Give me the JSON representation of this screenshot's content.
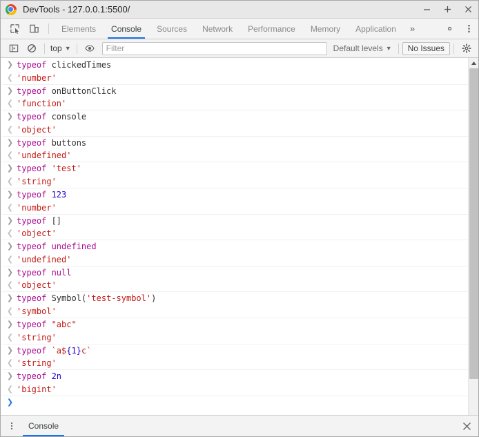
{
  "window": {
    "title": "DevTools - 127.0.0.1:5500/",
    "logo_icon": "chrome-logo-icon",
    "controls": {
      "minimize": "minimize-icon",
      "maximize": "maximize-icon",
      "close": "close-icon"
    }
  },
  "tabstrip": {
    "inspect_icon": "inspect-element-icon",
    "device_icon": "device-toolbar-icon",
    "tabs": [
      {
        "label": "Elements",
        "active": false
      },
      {
        "label": "Console",
        "active": true
      },
      {
        "label": "Sources",
        "active": false
      },
      {
        "label": "Network",
        "active": false
      },
      {
        "label": "Performance",
        "active": false
      },
      {
        "label": "Memory",
        "active": false
      },
      {
        "label": "Application",
        "active": false
      }
    ],
    "more_label": "»",
    "settings_icon": "gear-icon",
    "menu_icon": "kebab-menu-icon"
  },
  "console_toolbar": {
    "sidebar_icon": "console-sidebar-icon",
    "clear_icon": "clear-console-icon",
    "context": "top",
    "context_caret": "▼",
    "eye_icon": "live-expression-eye-icon",
    "filter_placeholder": "Filter",
    "filter_value": "",
    "levels_label": "Default levels",
    "levels_caret": "▼",
    "issues_label": "No Issues",
    "settings_icon": "console-settings-gear-icon"
  },
  "console": {
    "input_marker": "❯",
    "result_marker": "❮",
    "prompt_marker": "❯",
    "entries": [
      {
        "input": [
          {
            "t": "typeof ",
            "c": "kw"
          },
          {
            "t": "clickedTimes",
            "c": "id"
          }
        ],
        "result": [
          {
            "t": "'number'",
            "c": "str"
          }
        ]
      },
      {
        "input": [
          {
            "t": "typeof ",
            "c": "kw"
          },
          {
            "t": "onButtonClick",
            "c": "id"
          }
        ],
        "result": [
          {
            "t": "'function'",
            "c": "str"
          }
        ]
      },
      {
        "input": [
          {
            "t": "typeof ",
            "c": "kw"
          },
          {
            "t": "console",
            "c": "id"
          }
        ],
        "result": [
          {
            "t": "'object'",
            "c": "str"
          }
        ]
      },
      {
        "input": [
          {
            "t": "typeof ",
            "c": "kw"
          },
          {
            "t": "buttons",
            "c": "id"
          }
        ],
        "result": [
          {
            "t": "'undefined'",
            "c": "str"
          }
        ]
      },
      {
        "input": [
          {
            "t": "typeof ",
            "c": "kw"
          },
          {
            "t": "'test'",
            "c": "str"
          }
        ],
        "result": [
          {
            "t": "'string'",
            "c": "str"
          }
        ]
      },
      {
        "input": [
          {
            "t": "typeof ",
            "c": "kw"
          },
          {
            "t": "123",
            "c": "num"
          }
        ],
        "result": [
          {
            "t": "'number'",
            "c": "str"
          }
        ]
      },
      {
        "input": [
          {
            "t": "typeof ",
            "c": "kw"
          },
          {
            "t": "[]",
            "c": "punc"
          }
        ],
        "result": [
          {
            "t": "'object'",
            "c": "str"
          }
        ]
      },
      {
        "input": [
          {
            "t": "typeof ",
            "c": "kw"
          },
          {
            "t": "undefined",
            "c": "kw"
          }
        ],
        "result": [
          {
            "t": "'undefined'",
            "c": "str"
          }
        ]
      },
      {
        "input": [
          {
            "t": "typeof ",
            "c": "kw"
          },
          {
            "t": "null",
            "c": "kw"
          }
        ],
        "result": [
          {
            "t": "'object'",
            "c": "str"
          }
        ]
      },
      {
        "input": [
          {
            "t": "typeof ",
            "c": "kw"
          },
          {
            "t": "Symbol",
            "c": "id"
          },
          {
            "t": "(",
            "c": "punc"
          },
          {
            "t": "'test-symbol'",
            "c": "str"
          },
          {
            "t": ")",
            "c": "punc"
          }
        ],
        "result": [
          {
            "t": "'symbol'",
            "c": "str"
          }
        ]
      },
      {
        "input": [
          {
            "t": "typeof ",
            "c": "kw"
          },
          {
            "t": "\"abc\"",
            "c": "str"
          }
        ],
        "result": [
          {
            "t": "'string'",
            "c": "str"
          }
        ]
      },
      {
        "input": [
          {
            "t": "typeof ",
            "c": "kw"
          },
          {
            "t": "`a$",
            "c": "str"
          },
          {
            "t": "{",
            "c": "tpl-brace"
          },
          {
            "t": "1",
            "c": "num"
          },
          {
            "t": "}",
            "c": "tpl-brace"
          },
          {
            "t": "c`",
            "c": "str"
          }
        ],
        "result": [
          {
            "t": "'string'",
            "c": "str"
          }
        ]
      },
      {
        "input": [
          {
            "t": "typeof ",
            "c": "kw"
          },
          {
            "t": "2n",
            "c": "num"
          }
        ],
        "result": [
          {
            "t": "'bigint'",
            "c": "str"
          }
        ]
      }
    ]
  },
  "drawer": {
    "menu_icon": "kebab-menu-icon",
    "tab_label": "Console",
    "close_icon": "close-drawer-icon"
  }
}
